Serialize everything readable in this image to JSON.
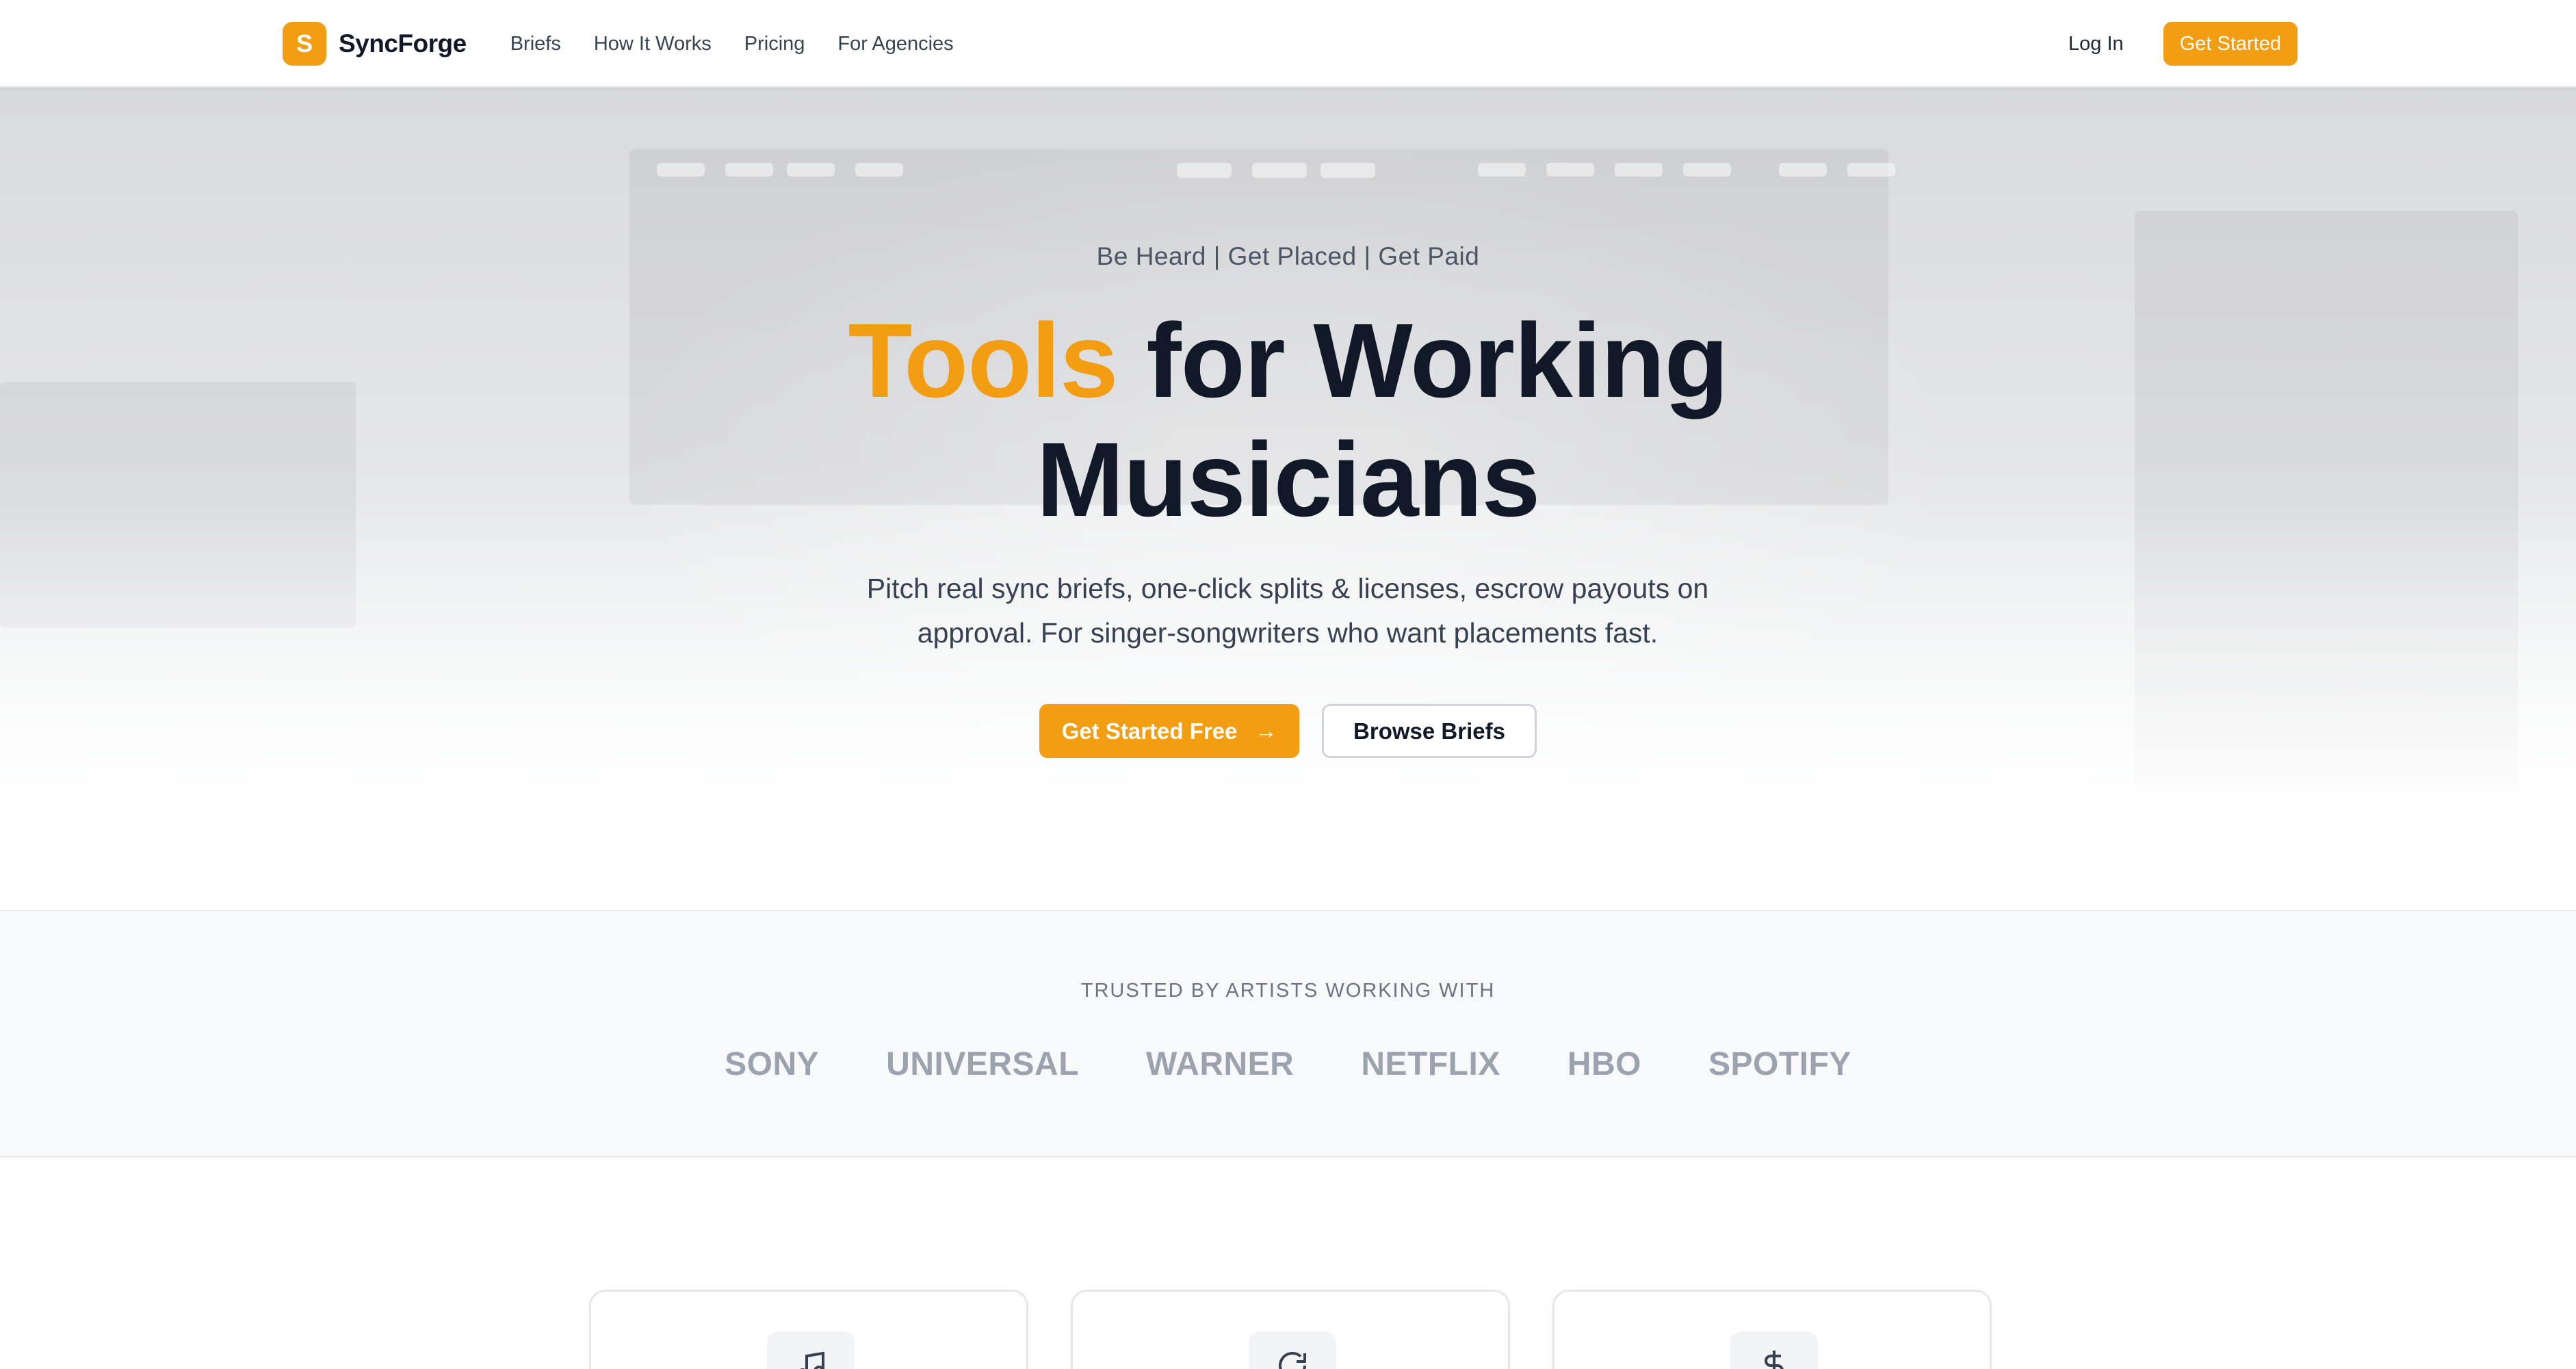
{
  "nav": {
    "logo_letter": "S",
    "brand": "SyncForge",
    "links": [
      "Briefs",
      "How It Works",
      "Pricing",
      "For Agencies"
    ],
    "login": "Log In",
    "cta": "Get Started"
  },
  "hero": {
    "tagline": "Be Heard | Get Placed | Get Paid",
    "headline_accent": "Tools",
    "headline_line1_rest": " for Working",
    "headline_line2": "Musicians",
    "subtext": "Pitch real sync briefs, one-click splits & licenses, escrow payouts on approval. For singer-songwriters who want placements fast.",
    "primary_button": "Get Started Free",
    "primary_button_icon": "arrow-right-icon",
    "secondary_button": "Browse Briefs"
  },
  "trusted": {
    "label": "TRUSTED BY ARTISTS WORKING WITH",
    "brands": [
      "SONY",
      "UNIVERSAL",
      "WARNER",
      "NETFLIX",
      "HBO",
      "SPOTIFY"
    ]
  },
  "features": {
    "icons": [
      "music-note-icon",
      "refresh-icon",
      "dollar-icon"
    ]
  },
  "colors": {
    "accent": "#f29d12",
    "text_dark": "#111827"
  }
}
